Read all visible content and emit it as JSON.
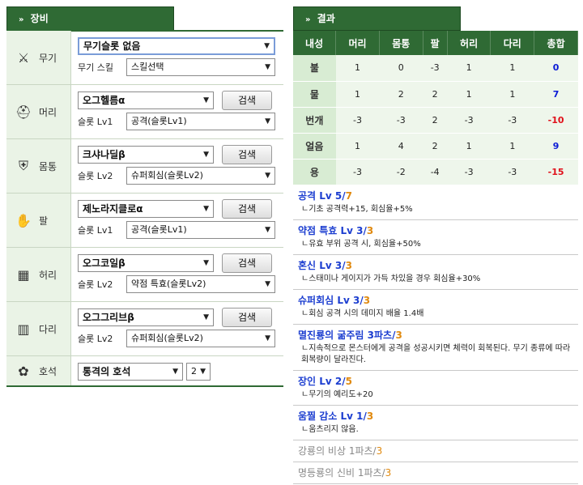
{
  "left_tab": {
    "arrow": "»",
    "label": "장비"
  },
  "right_tab": {
    "arrow": "»",
    "label": "결과"
  },
  "search_label": "검색",
  "equip": [
    {
      "label": "무기",
      "icon": "weapon-icon",
      "item": "무기슬롯 없음",
      "slot_label": "무기 스킬",
      "slot_value": "스킬선택",
      "has_search": false
    },
    {
      "label": "머리",
      "icon": "helmet-icon",
      "item": "오그헬름α",
      "slot_label": "슬롯 Lv1",
      "slot_value": "공격(슬롯Lv1)",
      "has_search": true
    },
    {
      "label": "몸통",
      "icon": "armor-icon",
      "item": "크샤나딜β",
      "slot_label": "슬롯 Lv2",
      "slot_value": "슈퍼회심(슬롯Lv2)",
      "has_search": true
    },
    {
      "label": "팔",
      "icon": "gauntlet-icon",
      "item": "제노라지클로α",
      "slot_label": "슬롯 Lv1",
      "slot_value": "공격(슬롯Lv1)",
      "has_search": true
    },
    {
      "label": "허리",
      "icon": "waist-icon",
      "item": "오그코일β",
      "slot_label": "슬롯 Lv2",
      "slot_value": "약점 특효(슬롯Lv2)",
      "has_search": true
    },
    {
      "label": "다리",
      "icon": "leg-armor-icon",
      "item": "오그그리브β",
      "slot_label": "슬롯 Lv2",
      "slot_value": "슈퍼회심(슬롯Lv2)",
      "has_search": true
    }
  ],
  "charm": {
    "label": "호석",
    "icon": "charm-icon",
    "item": "통격의 호석",
    "level": "2"
  },
  "resist_table": {
    "headers": [
      "내성",
      "머리",
      "몸통",
      "팔",
      "허리",
      "다리",
      "총합"
    ],
    "rows": [
      {
        "name": "불",
        "vals": [
          "1",
          "0",
          "-3",
          "1",
          "1"
        ],
        "total": "0",
        "total_class": "pos"
      },
      {
        "name": "물",
        "vals": [
          "1",
          "2",
          "2",
          "1",
          "1"
        ],
        "total": "7",
        "total_class": "pos"
      },
      {
        "name": "번개",
        "vals": [
          "-3",
          "-3",
          "2",
          "-3",
          "-3"
        ],
        "total": "-10",
        "total_class": "neg"
      },
      {
        "name": "얼음",
        "vals": [
          "1",
          "4",
          "2",
          "1",
          "1"
        ],
        "total": "9",
        "total_class": "pos"
      },
      {
        "name": "용",
        "vals": [
          "-3",
          "-2",
          "-4",
          "-3",
          "-3"
        ],
        "total": "-15",
        "total_class": "neg"
      }
    ]
  },
  "skills": [
    {
      "name": "공격 Lv 5/",
      "max": "7",
      "desc": "ㄴ기초 공격력+15, 회심율+5%",
      "active": true
    },
    {
      "name": "약점 특효 Lv 3/",
      "max": "3",
      "desc": "ㄴ유효 부위 공격 시, 회심율+50%",
      "active": true
    },
    {
      "name": "혼신 Lv 3/",
      "max": "3",
      "desc": "ㄴ스태미나 게이지가 가득 차있을 경우 회심율+30%",
      "active": true
    },
    {
      "name": "슈퍼회심 Lv 3/",
      "max": "3",
      "desc": "ㄴ회심 공격 시의 데미지 배율 1.4배",
      "active": true
    },
    {
      "name": "멸진룡의 굶주림 3파츠/",
      "max": "3",
      "desc": "ㄴ지속적으로 몬스터에게 공격을 성공시키면 체력이 회복된다. 무기 종류에 따라 회복량이 달라진다.",
      "active": true
    },
    {
      "name": "장인 Lv 2/",
      "max": "5",
      "desc": "ㄴ무기의 예리도+20",
      "active": true
    },
    {
      "name": "움찔 감소 Lv 1/",
      "max": "3",
      "desc": "ㄴ움츠리지 않음.",
      "active": true
    },
    {
      "name": "강룡의 비상 1파츠/",
      "max": "3",
      "desc": "",
      "active": false
    },
    {
      "name": "명등룡의 신비 1파츠/",
      "max": "3",
      "desc": "",
      "active": false
    }
  ]
}
